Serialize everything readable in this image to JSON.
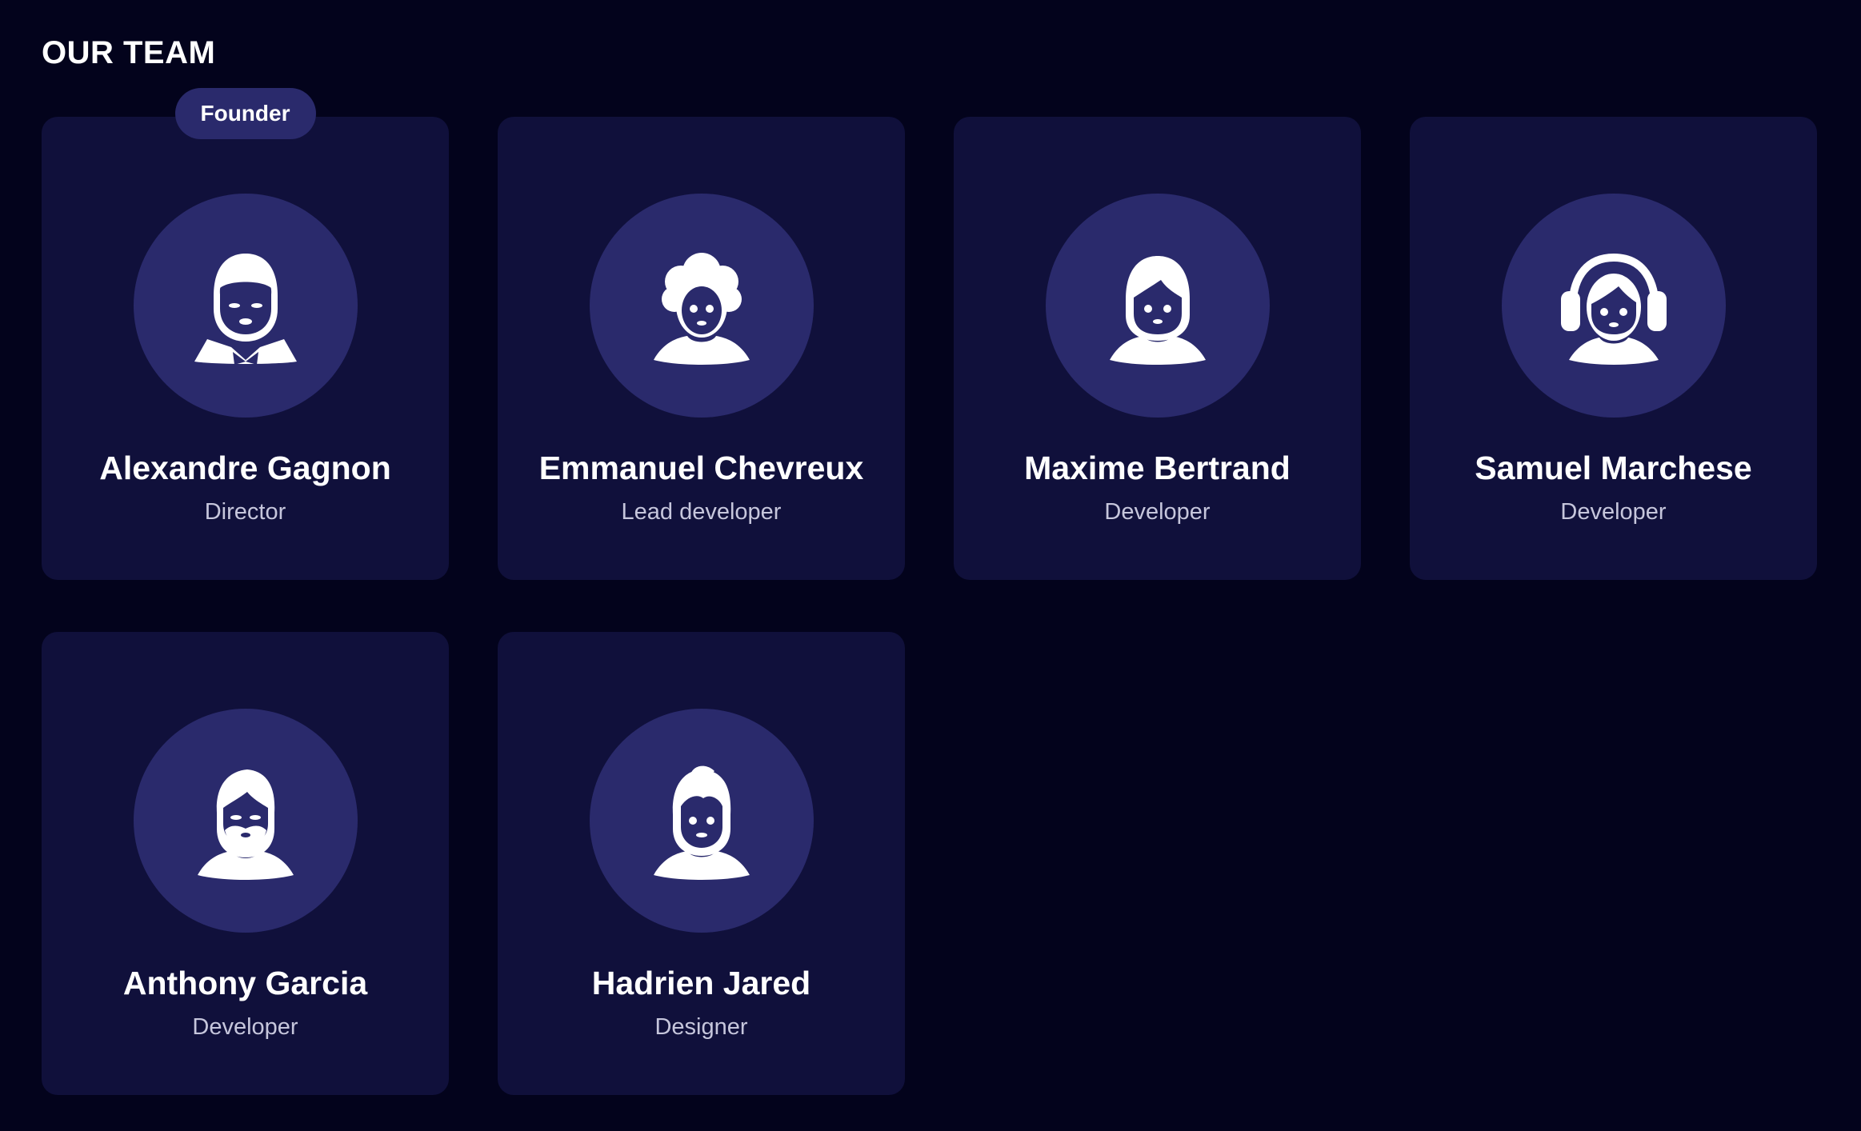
{
  "page": {
    "title": "OUR TEAM"
  },
  "colors": {
    "background": "#03031c",
    "card": "#10103b",
    "accent": "#2a2a6c",
    "text": "#ffffff",
    "muted_text": "#c6c6dc"
  },
  "team": [
    {
      "name": "Alexandre Gagnon",
      "role": "Director",
      "badge": "Founder",
      "icon": "man-bowtie-icon"
    },
    {
      "name": "Emmanuel Chevreux",
      "role": "Lead developer",
      "icon": "curly-hair-person-icon"
    },
    {
      "name": "Maxime Bertrand",
      "role": "Developer",
      "icon": "woman-bob-hair-icon"
    },
    {
      "name": "Samuel Marchese",
      "role": "Developer",
      "icon": "person-headphones-icon"
    },
    {
      "name": "Anthony Garcia",
      "role": "Developer",
      "icon": "bearded-man-icon"
    },
    {
      "name": "Hadrien Jared",
      "role": "Designer",
      "icon": "young-man-icon"
    }
  ]
}
